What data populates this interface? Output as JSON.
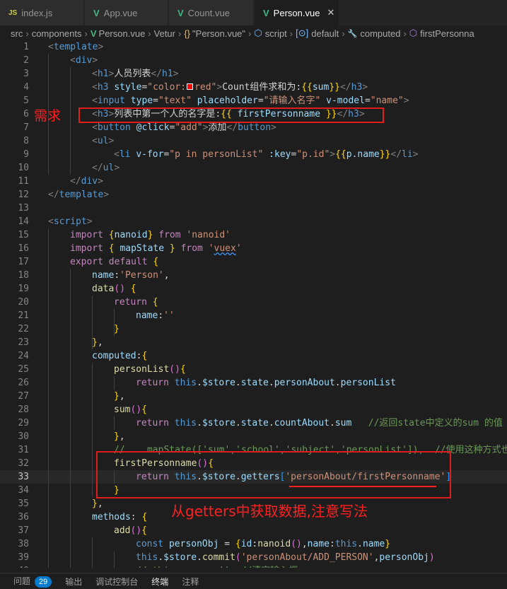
{
  "tabs": [
    {
      "label": "index.js",
      "icon": "JS",
      "active": false
    },
    {
      "label": "App.vue",
      "icon": "V",
      "active": false
    },
    {
      "label": "Count.vue",
      "icon": "V",
      "active": false
    },
    {
      "label": "Person.vue",
      "icon": "V",
      "active": true
    }
  ],
  "breadcrumb": [
    "src",
    "components",
    "Person.vue",
    "Vetur",
    "\"Person.vue\"",
    "script",
    "default",
    "computed",
    "firstPersonna"
  ],
  "breadcrumb_symbols": {
    "object": "{}",
    "script_icon": "⬡",
    "default_icon": "[⊙]",
    "computed_icon": "🔧",
    "method_icon": "⬡"
  },
  "current_line": 33,
  "annotations": {
    "requirement_label": "需求",
    "getters_note": "从getters中获取数据,注意写法"
  },
  "code_lines": [
    "<template>",
    "    <div>",
    "        <h1>人员列表</h1>",
    "        <h3 style=\"color: red\">Count组件求和为:{{sum}}</h3>",
    "        <input type=\"text\" placeholder=\"请输入名字\" v-model=\"name\">",
    "        <h3>列表中第一个人的名字是:{{ firstPersonname }}</h3>",
    "        <button @click=\"add\">添加</button>",
    "        <ul>",
    "            <li v-for=\"p in personList\" :key=\"p.id\">{{p.name}}</li>",
    "        </ul>",
    "    </div>",
    "</template>",
    "",
    "<script>",
    "    import {nanoid} from 'nanoid'",
    "    import { mapState } from 'vuex'",
    "    export default {",
    "        name:'Person',",
    "        data() {",
    "            return {",
    "                name:''",
    "            }",
    "        },",
    "        computed:{",
    "            personList(){",
    "                return this.$store.state.personAbout.personList",
    "            },",
    "            sum(){",
    "                return this.$store.state.countAbout.sum   //返回state中定义的sum 的值",
    "            },",
    "            // ...mapState(['sum','school','subject','personList']),  //使用这种方式也",
    "            firstPersonname(){",
    "                return this.$store.getters['personAbout/firstPersonname']",
    "            }",
    "        },",
    "        methods: {",
    "            add(){",
    "                const personObj = {id:nanoid(),name:this.name}",
    "                this.$store.commit('personAbout/ADD_PERSON',personObj)",
    "                // this.name = ''  //清空输入框",
    "            }"
  ],
  "statusbar": [
    {
      "label": "问题",
      "badge": "29"
    },
    {
      "label": "输出"
    },
    {
      "label": "调试控制台"
    },
    {
      "label": "终端",
      "active": true
    },
    {
      "label": "注释"
    }
  ],
  "colors": {
    "accent": "#007acc",
    "annotation": "#ff2020",
    "vue": "#41b883"
  }
}
